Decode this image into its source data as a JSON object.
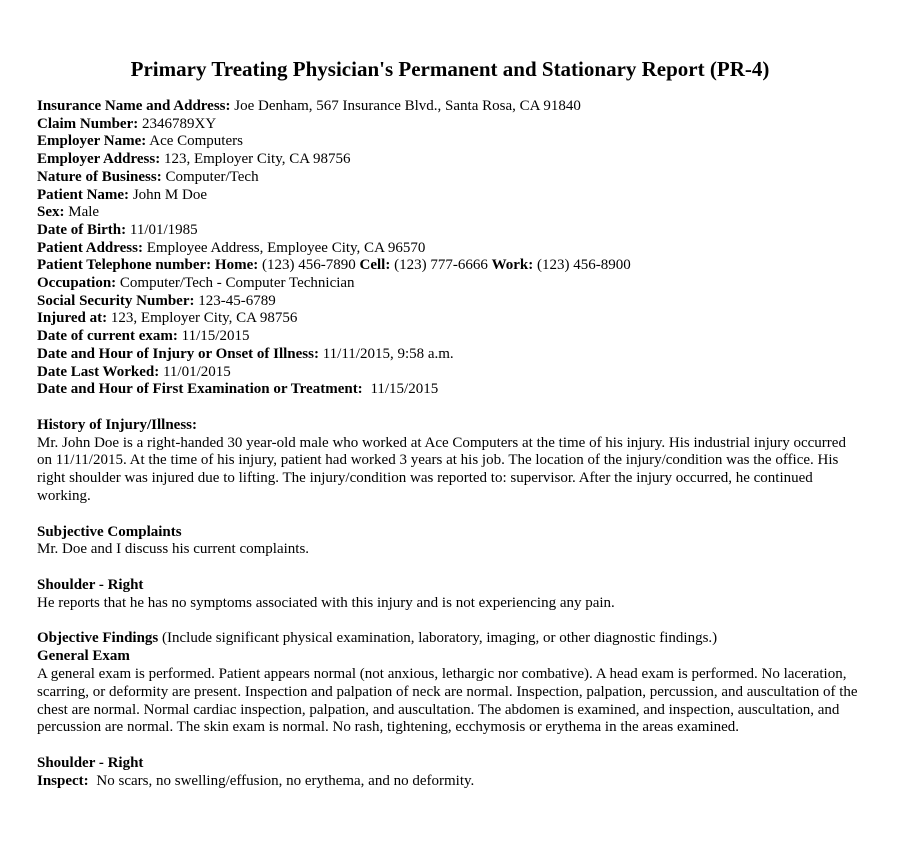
{
  "title": "Primary Treating Physician's Permanent and Stationary Report (PR-4)",
  "fields": {
    "insurance": {
      "label": "Insurance Name and Address:",
      "value": "Joe Denham, 567 Insurance Blvd., Santa Rosa, CA 91840"
    },
    "claim_number": {
      "label": "Claim Number:",
      "value": "2346789XY"
    },
    "employer_name": {
      "label": "Employer Name:",
      "value": "Ace Computers"
    },
    "employer_address": {
      "label": "Employer Address:",
      "value": "123, Employer City, CA 98756"
    },
    "nature_of_business": {
      "label": "Nature of Business:",
      "value": "Computer/Tech"
    },
    "patient_name": {
      "label": "Patient Name:",
      "value": "John M Doe"
    },
    "sex": {
      "label": "Sex:",
      "value": "Male"
    },
    "dob": {
      "label": "Date of Birth:",
      "value": "11/01/1985"
    },
    "patient_address": {
      "label": "Patient Address:",
      "value": "Employee Address, Employee City, CA 96570"
    },
    "phones": {
      "label": "Patient Telephone number: Home:",
      "home": "(123) 456-7890",
      "cell_label": "Cell:",
      "cell": "(123) 777-6666",
      "work_label": "Work:",
      "work": "(123) 456-8900"
    },
    "occupation": {
      "label": "Occupation:",
      "value": "Computer/Tech - Computer Technician"
    },
    "ssn": {
      "label": "Social Security Number:",
      "value": "123-45-6789"
    },
    "injured_at": {
      "label": "Injured at:",
      "value": "123, Employer City, CA 98756"
    },
    "current_exam": {
      "label": "Date of current exam:",
      "value": "11/15/2015"
    },
    "injury_onset": {
      "label": "Date and Hour of Injury or Onset of Illness:",
      "value": "11/11/2015, 9:58 a.m."
    },
    "last_worked": {
      "label": "Date Last Worked:",
      "value": "11/01/2015"
    },
    "first_exam": {
      "label": "Date and Hour of First Examination or Treatment:",
      "value": "11/15/2015"
    }
  },
  "history": {
    "heading": "History of Injury/Illness:",
    "text": "Mr. John Doe is a right-handed 30 year-old male who worked at Ace Computers at the time of his injury. His industrial injury occurred on 11/11/2015. At the time of his injury, patient had worked 3 years at his job. The location of the injury/condition was the office. His right shoulder was injured due to lifting. The injury/condition was reported to: supervisor. After the injury occurred, he continued working."
  },
  "subjective": {
    "heading": "Subjective Complaints",
    "text": "Mr. Doe and I discuss his current complaints."
  },
  "shoulder_subjective": {
    "heading": "Shoulder - Right",
    "text": "He reports that he has no symptoms associated with this injury and is not experiencing any pain."
  },
  "objective": {
    "heading": "Objective Findings",
    "note": "(Include significant physical examination, laboratory, imaging, or other diagnostic findings.)",
    "general_heading": "General Exam",
    "general_text": "A general exam is performed. Patient appears normal (not anxious, lethargic nor combative). A head exam is performed. No laceration, scarring, or deformity are present. Inspection and palpation of neck are normal. Inspection, palpation, percussion, and auscultation of the chest are normal. Normal cardiac inspection, palpation, and auscultation. The abdomen is examined, and inspection, auscultation, and percussion are normal. The skin exam is normal. No rash, tightening, ecchymosis or erythema in the areas examined."
  },
  "shoulder_objective": {
    "heading": "Shoulder - Right",
    "inspect_label": "Inspect:",
    "inspect_text": "No scars, no swelling/effusion, no erythema, and no deformity."
  }
}
